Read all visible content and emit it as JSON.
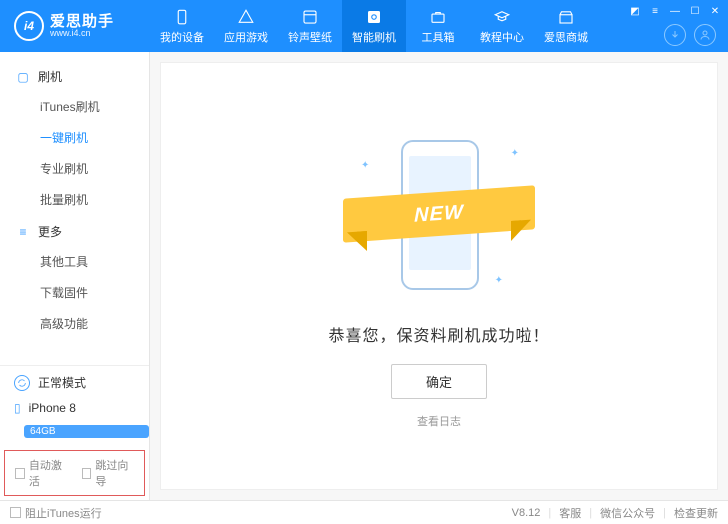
{
  "header": {
    "logo_zh": "爱思助手",
    "logo_en": "www.i4.cn",
    "logo_badge": "i4",
    "nav": [
      {
        "label": "我的设备"
      },
      {
        "label": "应用游戏"
      },
      {
        "label": "铃声壁纸"
      },
      {
        "label": "智能刷机",
        "active": true
      },
      {
        "label": "工具箱"
      },
      {
        "label": "教程中心"
      },
      {
        "label": "爱思商城"
      }
    ]
  },
  "sidebar": {
    "group1": {
      "title": "刷机",
      "items": [
        "iTunes刷机",
        "一键刷机",
        "专业刷机",
        "批量刷机"
      ],
      "active_index": 1
    },
    "group2": {
      "title": "更多",
      "items": [
        "其他工具",
        "下载固件",
        "高级功能"
      ]
    },
    "status": "正常模式",
    "device": {
      "name": "iPhone 8",
      "storage": "64GB"
    },
    "options": {
      "auto_activate": "自动激活",
      "skip_guide": "跳过向导"
    }
  },
  "main": {
    "ribbon": "NEW",
    "success": "恭喜您，保资料刷机成功啦！",
    "ok": "确定",
    "log": "查看日志"
  },
  "footer": {
    "block_itunes": "阻止iTunes运行",
    "version": "V8.12",
    "support": "客服",
    "wechat": "微信公众号",
    "update": "检查更新"
  }
}
